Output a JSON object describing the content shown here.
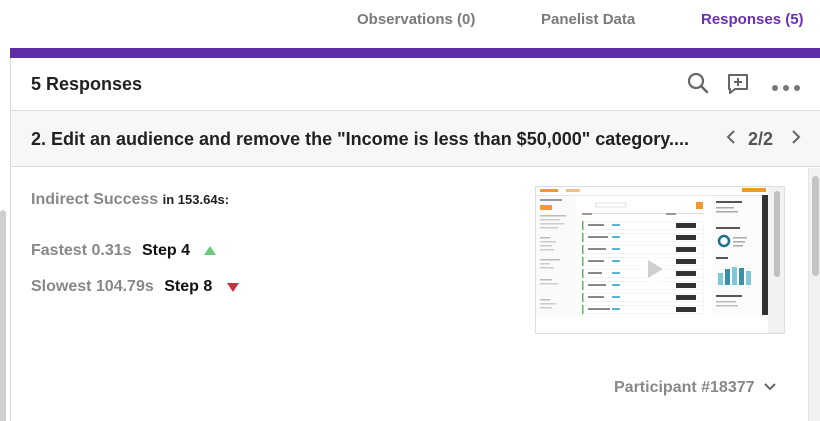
{
  "tabs": [
    {
      "label": "Observations (0)"
    },
    {
      "label": "Panelist Data"
    },
    {
      "label": "Responses (5)"
    }
  ],
  "header": {
    "title": "5 Responses",
    "icons": [
      "search-icon",
      "add-comment-icon",
      "more-icon"
    ]
  },
  "question": {
    "text": "2. Edit an audience and remove the \"Income is less than $50,000\" category....",
    "page": "2/2"
  },
  "result": {
    "status": "Indirect Success",
    "time_suffix": "in 153.64s:"
  },
  "fastest": {
    "label": "Fastest 0.31s",
    "step": "Step 4"
  },
  "slowest": {
    "label": "Slowest 104.79s",
    "step": "Step 8"
  },
  "participant": {
    "label": "Participant #18377"
  },
  "colors": {
    "accent": "#6a2fb5",
    "bar": "#5d2ea8",
    "up": "#6cc97a",
    "down": "#d42b45"
  }
}
